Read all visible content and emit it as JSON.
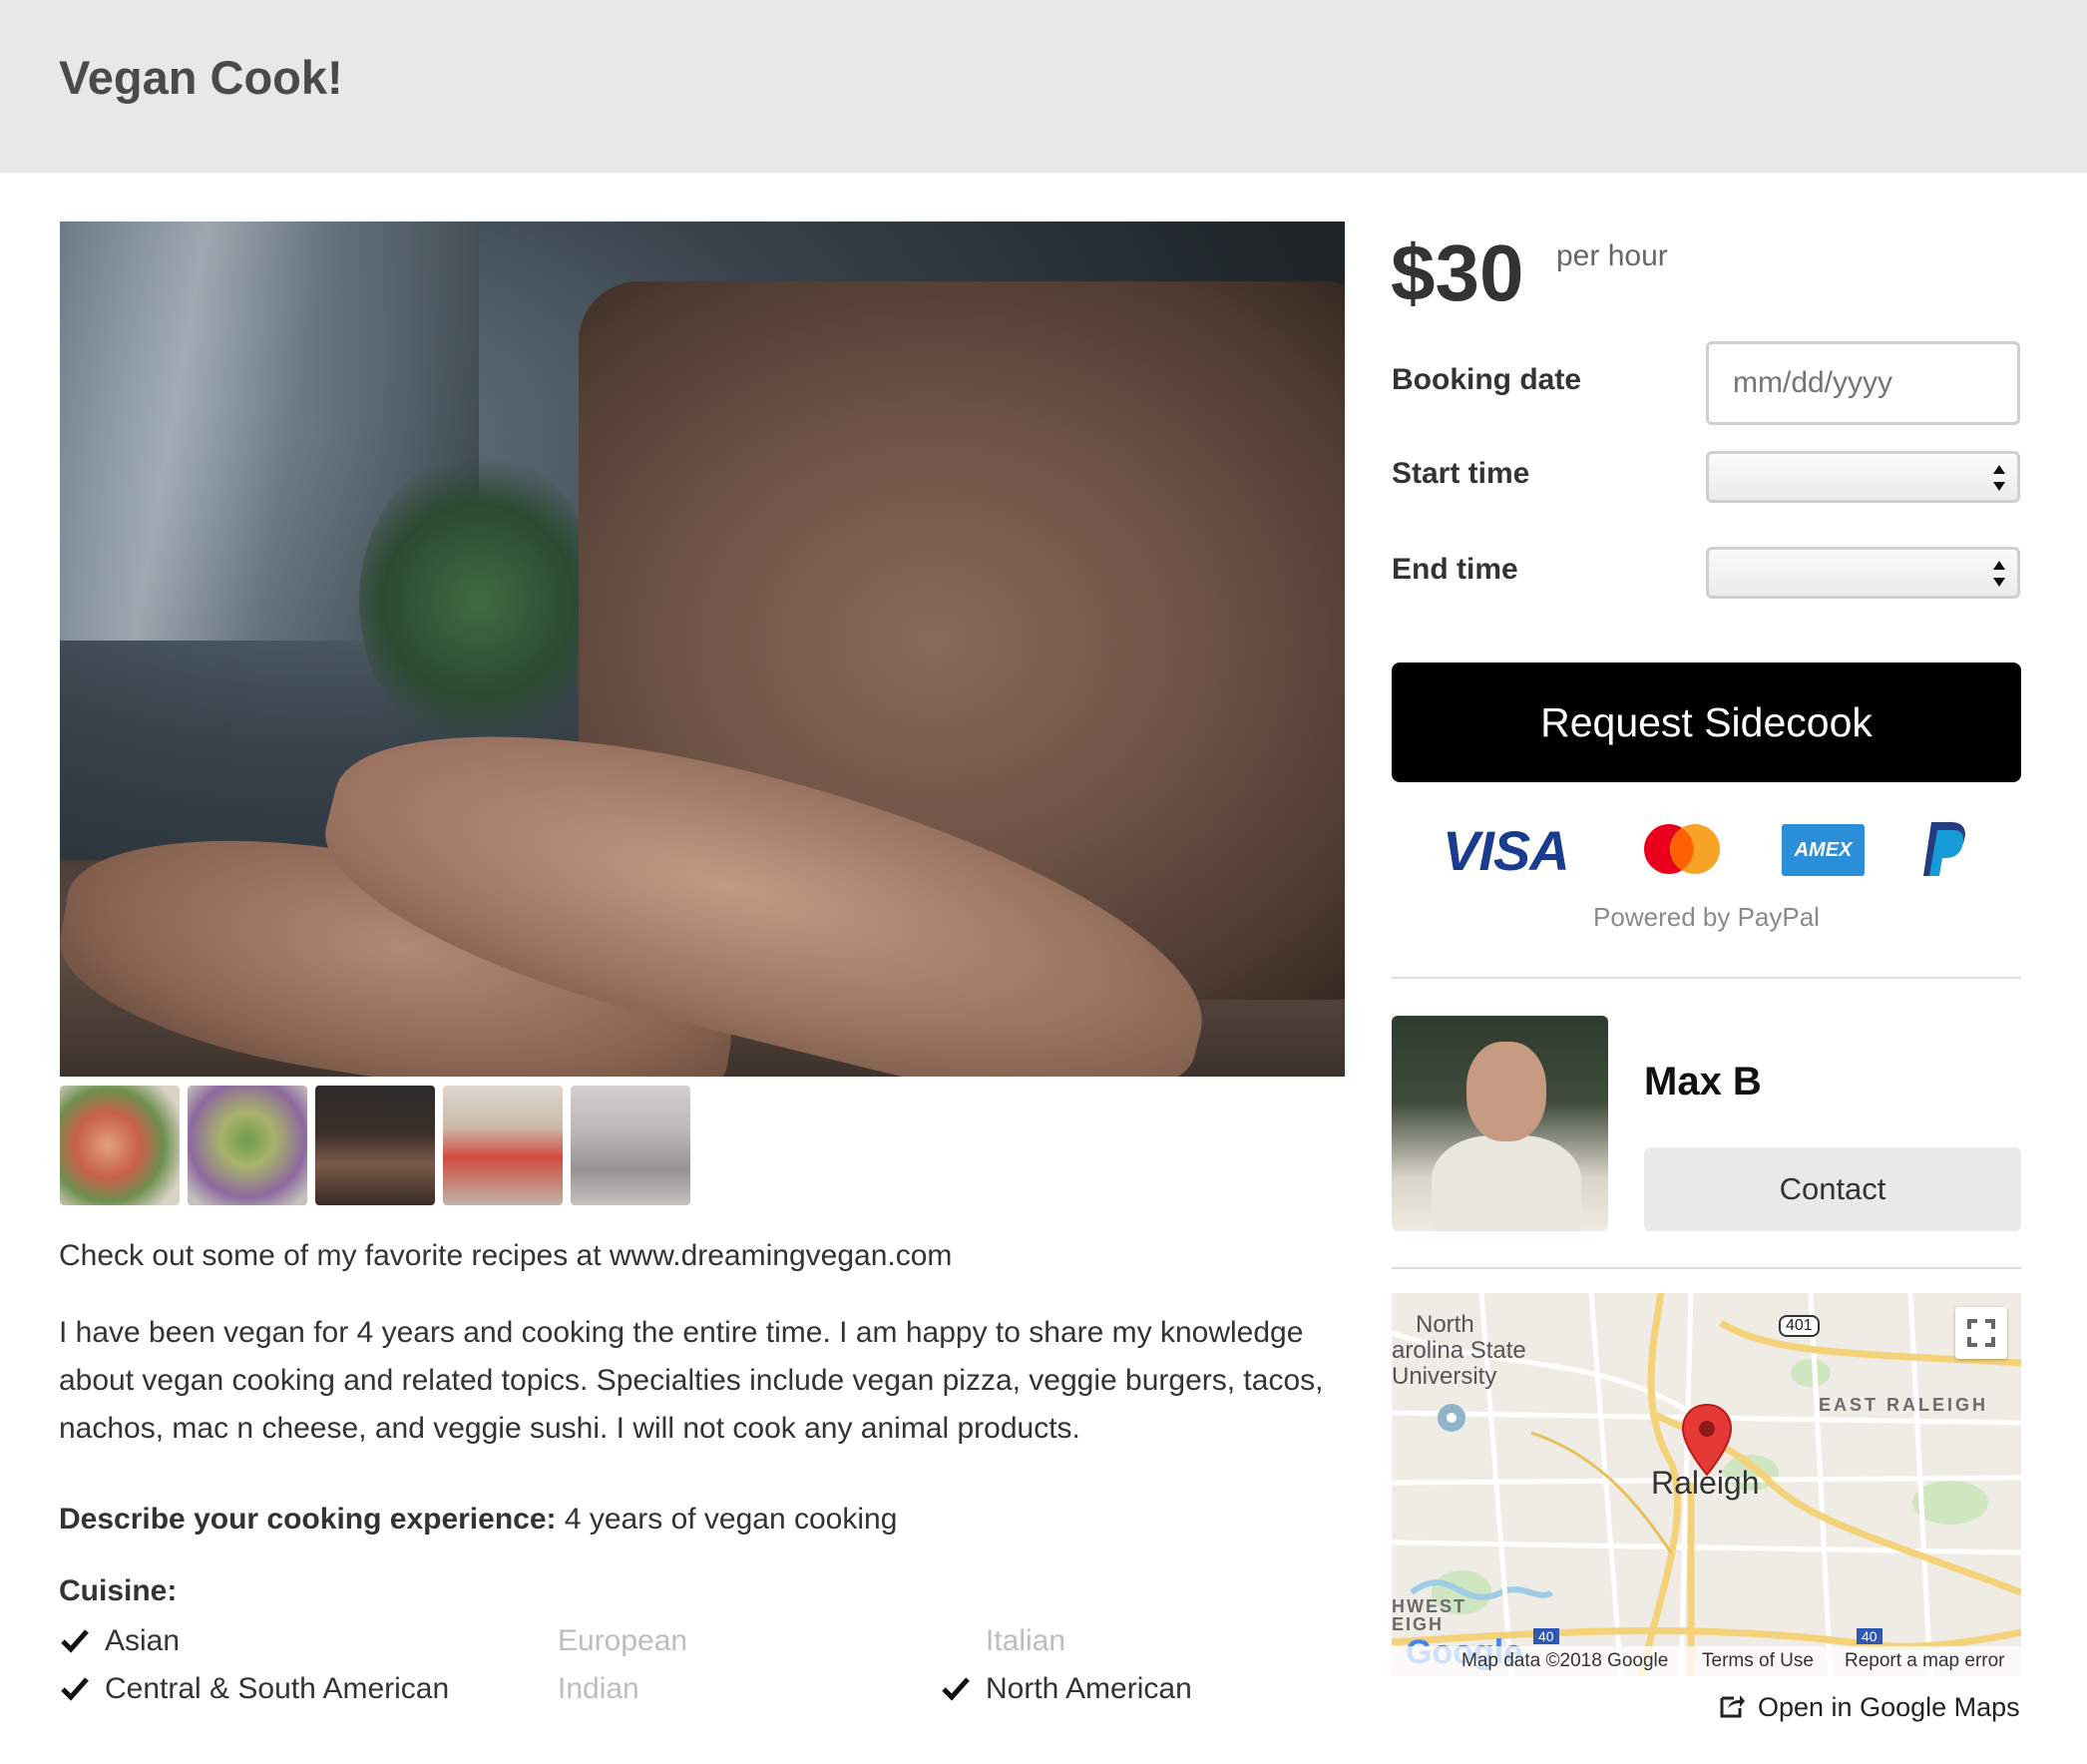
{
  "header": {
    "brand": "Vegan Cook!"
  },
  "listing": {
    "link_text": "Check out some of my favorite recipes at www.dreamingvegan.com",
    "about": "I have been vegan for 4 years and cooking the entire time. I am happy to share my knowledge about vegan cooking and related topics. Specialties include vegan pizza, veggie burgers, tacos, nachos, mac n cheese, and veggie sushi. I will not cook any animal products.",
    "experience_label": "Describe your cooking experience:",
    "experience_value": " 4 years of vegan cooking",
    "cuisine_heading": "Cuisine:",
    "cuisines": [
      {
        "name": "Asian",
        "checked": true
      },
      {
        "name": "European",
        "checked": false
      },
      {
        "name": "Italian",
        "checked": false
      },
      {
        "name": "Central & South American",
        "checked": true
      },
      {
        "name": "Indian",
        "checked": false
      },
      {
        "name": "North American",
        "checked": true
      }
    ],
    "thumbnail_count": 5
  },
  "booking": {
    "price": "$30",
    "per": "per hour",
    "date_label": "Booking date",
    "date_placeholder": "mm/dd/yyyy",
    "start_label": "Start time",
    "end_label": "End time",
    "request_button": "Request Sidecook",
    "payment_icons": [
      "visa-icon",
      "mastercard-icon",
      "amex-icon",
      "paypal-icon"
    ],
    "visa_text": "VISA",
    "amex_text": "AMEX",
    "powered_by": "Powered by PayPal"
  },
  "host": {
    "name": "Max B",
    "contact_button": "Contact"
  },
  "map": {
    "labels": {
      "ncsu_1": "North",
      "ncsu_2": "arolina State",
      "ncsu_3": "University",
      "east": "EAST RALEIGH",
      "city": "Raleigh",
      "hwest_1": "HWEST",
      "hwest_2": "EIGH",
      "route": "401",
      "interstate_1": "40",
      "interstate_2": "40"
    },
    "google": "Google",
    "map_data": "Map data ©2018 Google",
    "terms": "Terms of Use",
    "report": "Report a map error",
    "open_link": "Open in Google Maps"
  },
  "colors": {
    "header_bg": "#e8e8e8",
    "button_bg": "#000000",
    "contact_bg": "#e9e9e9",
    "pin_red": "#e53935",
    "check_color": "#111111"
  }
}
